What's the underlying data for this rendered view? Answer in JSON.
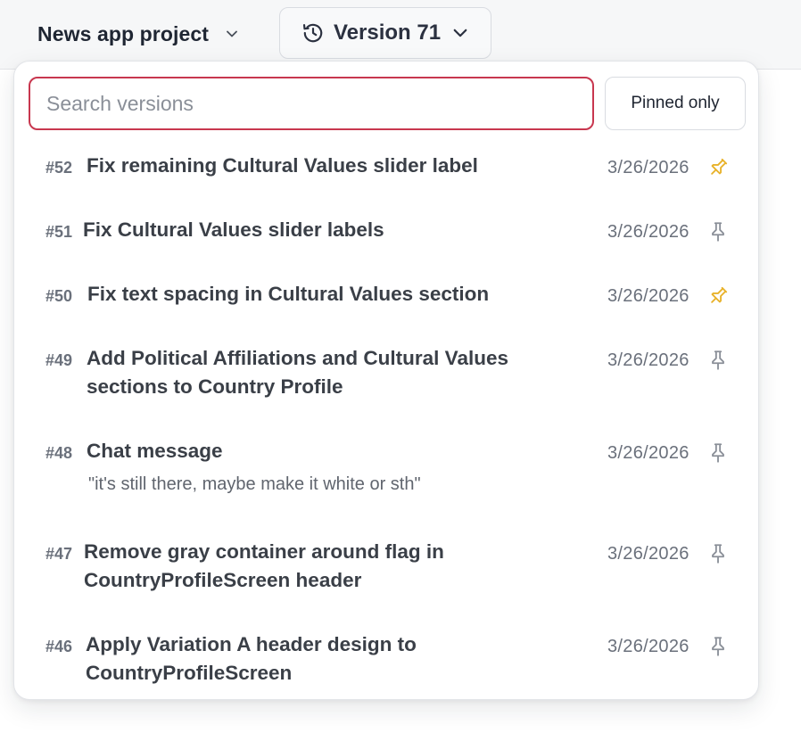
{
  "header": {
    "project_name": "News app project",
    "version_label": "Version 71"
  },
  "search": {
    "placeholder": "Search versions",
    "value": ""
  },
  "filter": {
    "pinned_only_label": "Pinned only"
  },
  "colors": {
    "pinned": "#e8b22a",
    "unpinned": "#8a8f98",
    "focus_border": "#c8374f"
  },
  "versions": [
    {
      "number": "#52",
      "title": "Fix remaining Cultural Values slider label",
      "date": "3/26/2026",
      "pinned": true,
      "icon": "pin-icon"
    },
    {
      "number": "#51",
      "title": "Fix Cultural Values slider labels",
      "date": "3/26/2026",
      "pinned": false,
      "icon": "pin-icon"
    },
    {
      "number": "#50",
      "title": "Fix text spacing in Cultural Values section",
      "date": "3/26/2026",
      "pinned": true,
      "icon": "pin-icon"
    },
    {
      "number": "#49",
      "title": "Add Political Affiliations and Cultural Values sections to Country Profile",
      "date": "3/26/2026",
      "pinned": false,
      "icon": "pin-icon"
    },
    {
      "number": "#48",
      "title": "Chat message",
      "subtitle": "\"it's still there, maybe make it white or sth\"",
      "date": "3/26/2026",
      "pinned": false,
      "icon": "pin-icon"
    },
    {
      "number": "#47",
      "title": "Remove gray container around flag in CountryProfileScreen header",
      "date": "3/26/2026",
      "pinned": false,
      "icon": "pin-icon"
    },
    {
      "number": "#46",
      "title": "Apply Variation A header design to CountryProfileScreen",
      "date": "3/26/2026",
      "pinned": false,
      "icon": "pin-icon"
    }
  ]
}
